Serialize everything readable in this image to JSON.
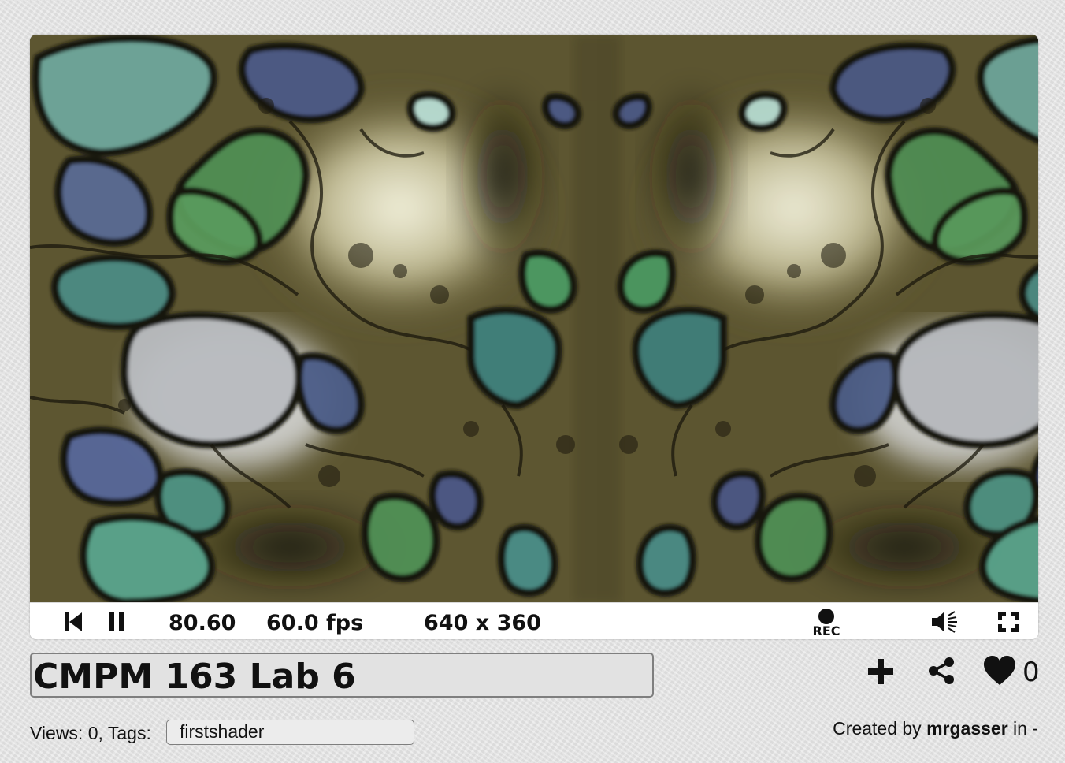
{
  "player": {
    "time": "80.60",
    "fps": "60.0 fps",
    "resolution": "640 x 360",
    "rec_label": "REC"
  },
  "icons": {
    "rewind": "skip-back-icon",
    "pause": "pause-icon",
    "record": "record-icon",
    "volume": "volume-icon",
    "fullscreen": "fullscreen-icon",
    "add": "plus-icon",
    "share": "share-icon",
    "like": "heart-icon"
  },
  "shader": {
    "title": "CMPM 163 Lab 6",
    "likes": "0",
    "views_label": "Views: 0, Tags:",
    "tag": "firstshader",
    "created_prefix": "Created by",
    "author": "mrgasser",
    "created_suffix": "in -"
  }
}
